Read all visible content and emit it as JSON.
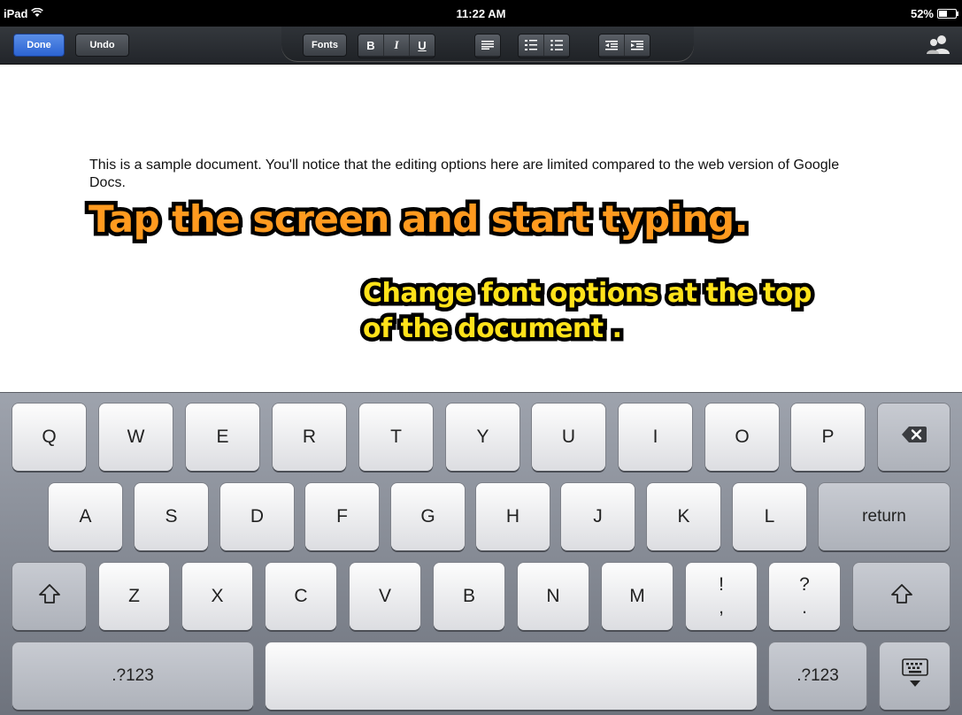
{
  "status_bar": {
    "device": "iPad",
    "time": "11:22 AM",
    "battery": "52%"
  },
  "toolbar": {
    "done_label": "Done",
    "undo_label": "Undo",
    "fonts_label": "Fonts",
    "bold_label": "B",
    "italic_label": "I",
    "underline_label": "U"
  },
  "document": {
    "body_text": "This is a sample document. You'll notice that the editing options here are limited compared to the web version of Google Docs."
  },
  "annotations": {
    "callout_1": "Tap the screen and start typing.",
    "callout_2_line1": "Change font options at the top",
    "callout_2_line2": "of the document ."
  },
  "keyboard": {
    "row1": [
      "Q",
      "W",
      "E",
      "R",
      "T",
      "Y",
      "U",
      "I",
      "O",
      "P"
    ],
    "row2": [
      "A",
      "S",
      "D",
      "F",
      "G",
      "H",
      "J",
      "K",
      "L"
    ],
    "return_label": "return",
    "row3": [
      "Z",
      "X",
      "C",
      "V",
      "B",
      "N",
      "M"
    ],
    "exclaim_top": "!",
    "exclaim_bottom": ",",
    "question_top": "?",
    "question_bottom": ".",
    "numbers_label": ".?123"
  },
  "colors": {
    "done_button": "#2c63d2",
    "callout_orange": "#ff9a1f",
    "callout_yellow": "#ffe21a"
  }
}
